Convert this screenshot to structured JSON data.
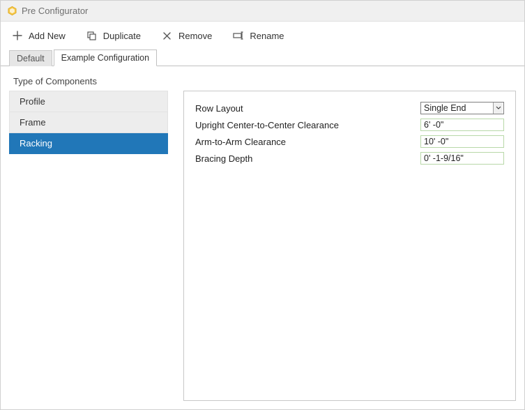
{
  "window": {
    "title": "Pre Configurator"
  },
  "toolbar": {
    "add": "Add New",
    "duplicate": "Duplicate",
    "remove": "Remove",
    "rename": "Rename"
  },
  "tabs": [
    {
      "label": "Default",
      "active": false
    },
    {
      "label": "Example Configuration",
      "active": true
    }
  ],
  "section_title": "Type of Components",
  "components": [
    {
      "label": "Profile",
      "selected": false
    },
    {
      "label": "Frame",
      "selected": false
    },
    {
      "label": "Racking",
      "selected": true
    }
  ],
  "properties": [
    {
      "label": "Row Layout",
      "type": "select",
      "value": "Single End"
    },
    {
      "label": "Upright Center-to-Center Clearance",
      "type": "text",
      "value": "6' -0\""
    },
    {
      "label": "Arm-to-Arm Clearance",
      "type": "text",
      "value": "10' -0\""
    },
    {
      "label": "Bracing Depth",
      "type": "text",
      "value": "0' -1-9/16\""
    }
  ]
}
